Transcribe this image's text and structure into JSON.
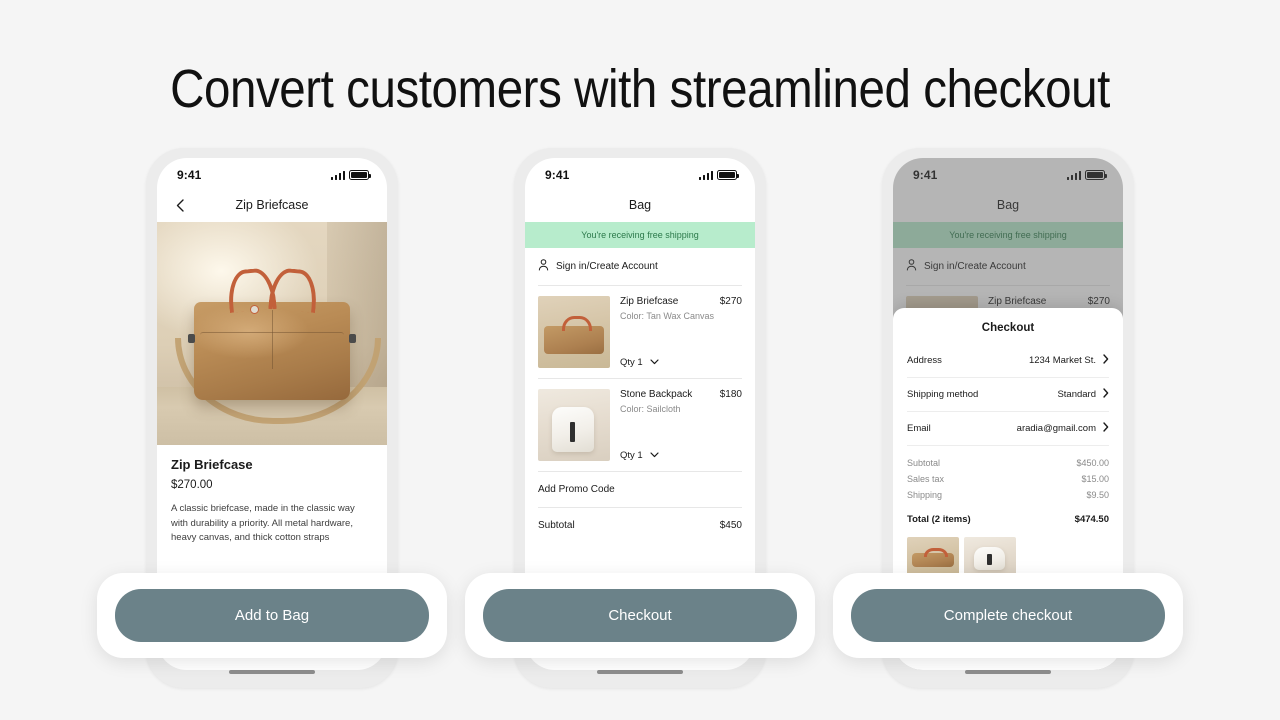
{
  "headline": "Convert customers with streamlined checkout",
  "theme": {
    "page_background": "#f5f5f5",
    "cta_color": "#6b8289",
    "free_shipping_banner": "#b7eccc",
    "free_shipping_text": "#2c7a4b"
  },
  "status_bar": {
    "time": "9:41",
    "signal_icon": "signal-bars-icon",
    "battery_icon": "battery-icon"
  },
  "screens": {
    "product": {
      "nav_title": "Zip Briefcase",
      "back_icon": "chevron-left-icon",
      "product_image_alt": "tan-canvas-briefcase-photo",
      "title": "Zip Briefcase",
      "price": "$270.00",
      "description": "A classic briefcase, made in the classic way with durability a priority. All metal hardware, heavy canvas, and thick cotton straps",
      "cta": "Add to Bag"
    },
    "bag": {
      "nav_title": "Bag",
      "free_shipping": "You're receiving free shipping",
      "sign_in_label": "Sign in/Create Account",
      "sign_in_icon": "person-icon",
      "items": [
        {
          "name": "Zip Briefcase",
          "price": "$270",
          "variant": "Color: Tan Wax Canvas",
          "qty_label": "Qty 1",
          "qty_icon": "chevron-down-icon",
          "thumb": "briefcase"
        },
        {
          "name": "Stone Backpack",
          "price": "$180",
          "variant": "Color: Sailcloth",
          "qty_label": "Qty 1",
          "qty_icon": "chevron-down-icon",
          "thumb": "backpack"
        }
      ],
      "promo_label": "Add Promo Code",
      "subtotal_label": "Subtotal",
      "subtotal_value": "$450",
      "cta": "Checkout"
    },
    "checkout": {
      "nav_title": "Bag",
      "free_shipping": "You're receiving free shipping",
      "sign_in_label": "Sign in/Create Account",
      "sign_in_icon": "person-icon",
      "background_item": {
        "name": "Zip Briefcase",
        "price": "$270"
      },
      "sheet_title": "Checkout",
      "rows": [
        {
          "label": "Address",
          "value": "1234 Market St.",
          "icon": "chevron-right-icon"
        },
        {
          "label": "Shipping method",
          "value": "Standard",
          "icon": "chevron-right-icon"
        },
        {
          "label": "Email",
          "value": "aradia@gmail.com",
          "icon": "chevron-right-icon"
        }
      ],
      "summary": [
        {
          "label": "Subtotal",
          "value": "$450.00"
        },
        {
          "label": "Sales tax",
          "value": "$15.00"
        },
        {
          "label": "Shipping",
          "value": "$9.50"
        }
      ],
      "total_label": "Total (2 items)",
      "total_value": "$474.50",
      "cta": "Complete checkout"
    }
  }
}
